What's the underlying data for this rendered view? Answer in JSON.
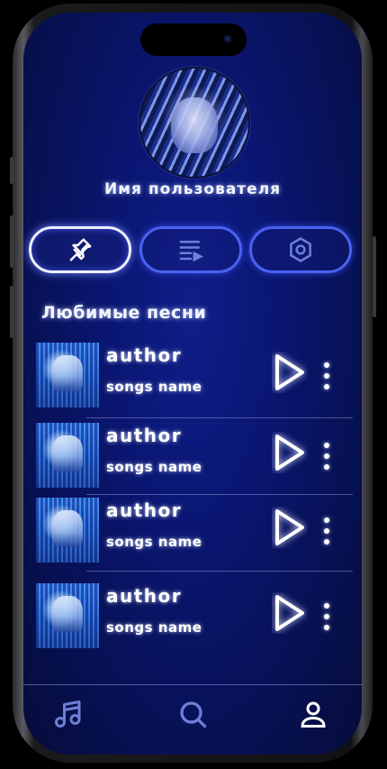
{
  "profile": {
    "username": "Имя пользователя"
  },
  "tabs": [
    {
      "icon": "pin-icon",
      "active": true
    },
    {
      "icon": "playlist-icon",
      "active": false
    },
    {
      "icon": "settings-icon",
      "active": false
    }
  ],
  "section": {
    "title": "Любимые песни"
  },
  "songs": [
    {
      "author": "author",
      "name": "songs name"
    },
    {
      "author": "author",
      "name": "songs name"
    },
    {
      "author": "author",
      "name": "songs name"
    },
    {
      "author": "author",
      "name": "songs name"
    }
  ],
  "navbar": {
    "items": [
      {
        "icon": "music-note-icon",
        "active": false
      },
      {
        "icon": "search-icon",
        "active": false
      },
      {
        "icon": "user-icon",
        "active": true
      }
    ]
  },
  "colors": {
    "background": "#0a1672",
    "accent": "#4b62f0",
    "active": "#eef0ff",
    "inactive_icon": "#6d7fd8"
  }
}
